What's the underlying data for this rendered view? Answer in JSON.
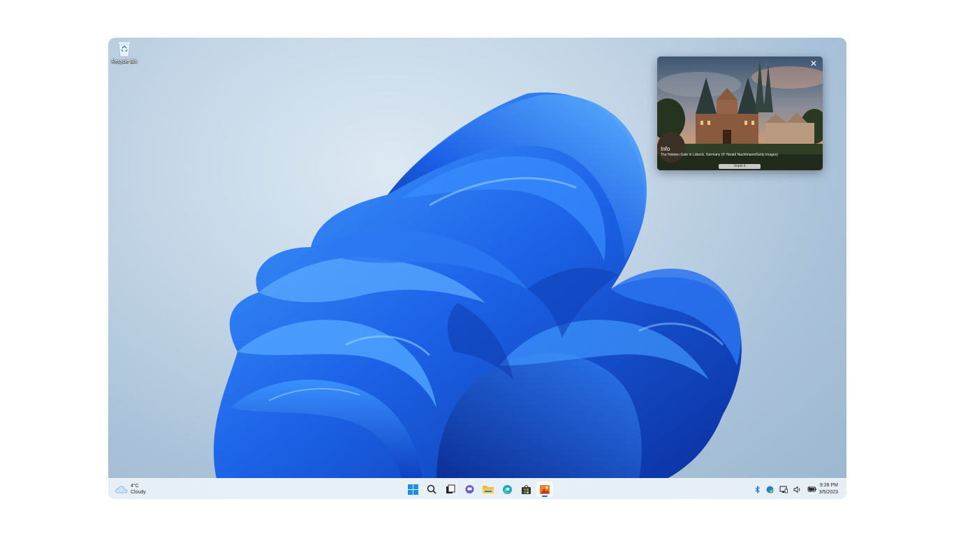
{
  "desktop": {
    "recycle_bin_label": "Recycle Bin"
  },
  "info_popup": {
    "title": "Info",
    "caption": "The Holsten Gate in Lübeck, Germany (© Harald Nachtmann/Getty Images)",
    "unpin_label": "Unpin it",
    "close_icon": "close-icon"
  },
  "taskbar": {
    "weather": {
      "temperature": "4°C",
      "condition": "Cloudy",
      "icon": "cloud-icon"
    },
    "apps": [
      {
        "name": "start",
        "icon": "windows-logo-icon"
      },
      {
        "name": "search",
        "icon": "search-icon"
      },
      {
        "name": "task-view",
        "icon": "task-view-icon"
      },
      {
        "name": "chat",
        "icon": "chat-icon"
      },
      {
        "name": "file-explorer",
        "icon": "folder-icon"
      },
      {
        "name": "edge",
        "icon": "edge-icon"
      },
      {
        "name": "store",
        "icon": "store-icon"
      },
      {
        "name": "wallpaper-app",
        "icon": "wallpaper-app-icon",
        "active": true
      }
    ],
    "tray": [
      "bluetooth-icon",
      "defender-icon",
      "network-icon",
      "volume-icon",
      "battery-icon"
    ],
    "clock": {
      "time": "9:28 PM",
      "date": "3/5/2023"
    }
  },
  "colors": {
    "accent": "#0b6fd6",
    "bloom_blue": "#1a5fe0"
  }
}
